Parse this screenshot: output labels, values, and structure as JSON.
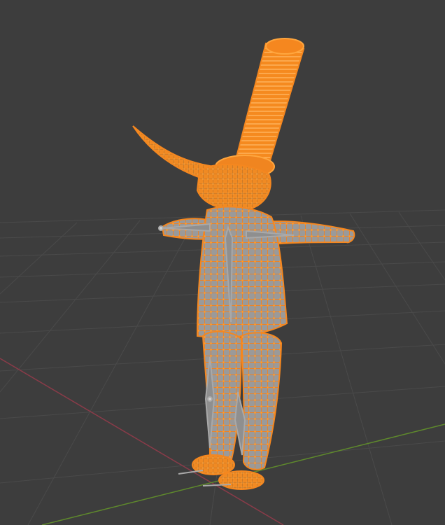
{
  "viewport": {
    "background": "#3d3d3d",
    "grid_color": "#4a4a4a",
    "grid_color_horizon": "#464646",
    "x_axis_color": "#8a3b49",
    "y_axis_color": "#5f8a2c"
  },
  "object": {
    "kind": "character mesh in edit mode with armature",
    "selection_color": "#f5871f",
    "vertex_color": "#ff9a2a",
    "shading_color": "#8c8c8c",
    "armature_color": "#a9a9a9",
    "selected": true
  }
}
